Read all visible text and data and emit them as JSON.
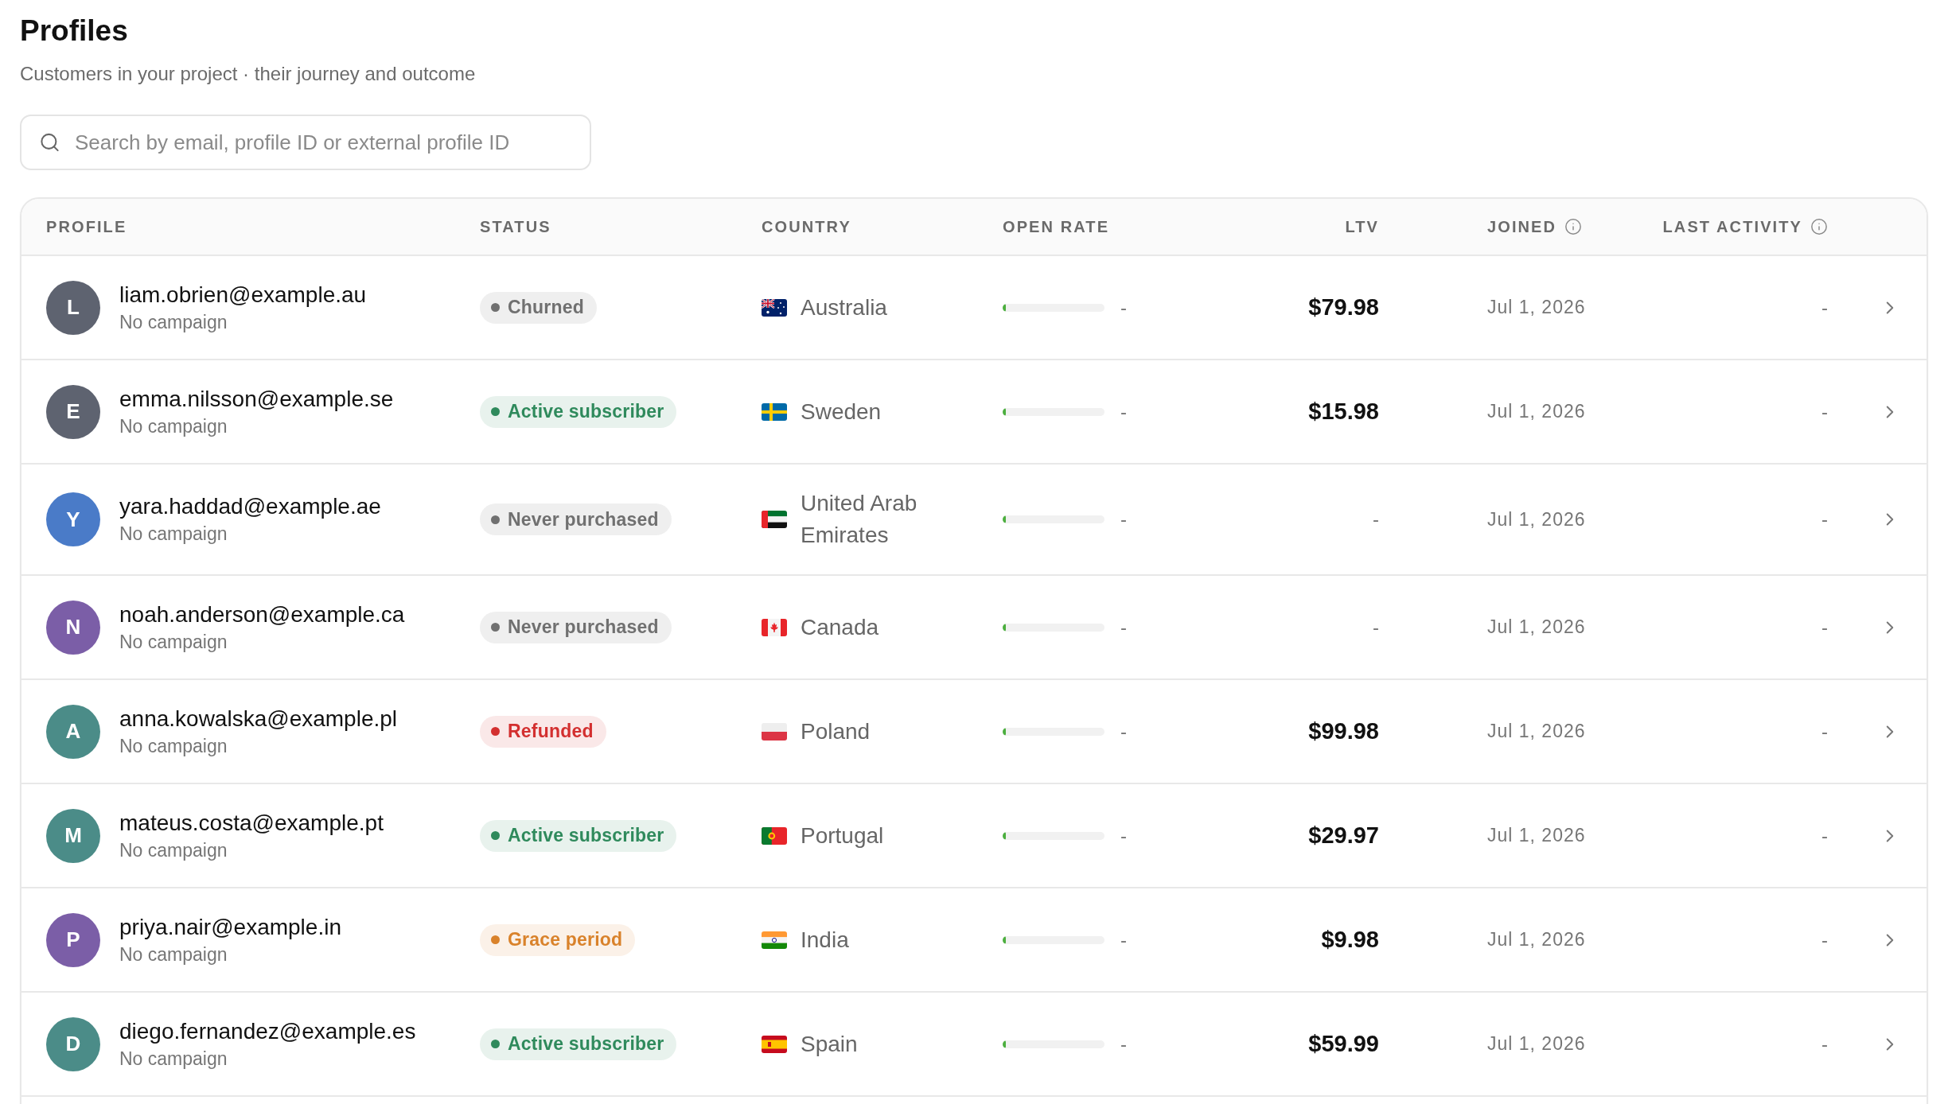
{
  "page": {
    "title": "Profiles",
    "subtitle": "Customers in your project · their journey and outcome"
  },
  "search": {
    "placeholder": "Search by email, profile ID or external profile ID"
  },
  "table": {
    "columns": [
      {
        "label": "PROFILE",
        "info": false
      },
      {
        "label": "STATUS",
        "info": false
      },
      {
        "label": "COUNTRY",
        "info": false
      },
      {
        "label": "OPEN RATE",
        "info": false
      },
      {
        "label": "LTV",
        "info": false
      },
      {
        "label": "JOINED",
        "info": true
      },
      {
        "label": "LAST ACTIVITY",
        "info": true
      }
    ],
    "rows": [
      {
        "avatar": {
          "initial": "L",
          "color": "#5e6370"
        },
        "email": "liam.obrien@example.au",
        "campaign": "No campaign",
        "status": {
          "label": "Churned",
          "color": "#707070"
        },
        "country": {
          "kind": "au",
          "name": "Australia"
        },
        "open_rate": {
          "level": 0.03,
          "reading": "-"
        },
        "ltv": {
          "kind": "amount",
          "text": "$79.98"
        },
        "joined": "Jul 1, 2026",
        "last_activity": "-"
      },
      {
        "avatar": {
          "initial": "E",
          "color": "#5e6370"
        },
        "email": "emma.nilsson@example.se",
        "campaign": "No campaign",
        "status": {
          "label": "Active subscriber",
          "color": "#2f8a5c"
        },
        "country": {
          "kind": "se",
          "name": "Sweden"
        },
        "open_rate": {
          "level": 0.03,
          "reading": "-"
        },
        "ltv": {
          "kind": "amount",
          "text": "$15.98"
        },
        "joined": "Jul 1, 2026",
        "last_activity": "-"
      },
      {
        "avatar": {
          "initial": "Y",
          "color": "#4a7bc8"
        },
        "email": "yara.haddad@example.ae",
        "campaign": "No campaign",
        "status": {
          "label": "Never purchased",
          "color": "#707070"
        },
        "country": {
          "kind": "ae",
          "name": "United Arab Emirates"
        },
        "open_rate": {
          "level": 0.03,
          "reading": "-"
        },
        "ltv": {
          "kind": "missing",
          "text": "-"
        },
        "joined": "Jul 1, 2026",
        "last_activity": "-"
      },
      {
        "avatar": {
          "initial": "N",
          "color": "#7b5ea7"
        },
        "email": "noah.anderson@example.ca",
        "campaign": "No campaign",
        "status": {
          "label": "Never purchased",
          "color": "#707070"
        },
        "country": {
          "kind": "ca",
          "name": "Canada"
        },
        "open_rate": {
          "level": 0.03,
          "reading": "-"
        },
        "ltv": {
          "kind": "missing",
          "text": "-"
        },
        "joined": "Jul 1, 2026",
        "last_activity": "-"
      },
      {
        "avatar": {
          "initial": "A",
          "color": "#4b8c88"
        },
        "email": "anna.kowalska@example.pl",
        "campaign": "No campaign",
        "status": {
          "label": "Refunded",
          "color": "#d32f2f"
        },
        "country": {
          "kind": "pl",
          "name": "Poland"
        },
        "open_rate": {
          "level": 0.03,
          "reading": "-"
        },
        "ltv": {
          "kind": "amount",
          "text": "$99.98"
        },
        "joined": "Jul 1, 2026",
        "last_activity": "-"
      },
      {
        "avatar": {
          "initial": "M",
          "color": "#4b8c88"
        },
        "email": "mateus.costa@example.pt",
        "campaign": "No campaign",
        "status": {
          "label": "Active subscriber",
          "color": "#2f8a5c"
        },
        "country": {
          "kind": "pt",
          "name": "Portugal"
        },
        "open_rate": {
          "level": 0.03,
          "reading": "-"
        },
        "ltv": {
          "kind": "amount",
          "text": "$29.97"
        },
        "joined": "Jul 1, 2026",
        "last_activity": "-"
      },
      {
        "avatar": {
          "initial": "P",
          "color": "#7b5ea7"
        },
        "email": "priya.nair@example.in",
        "campaign": "No campaign",
        "status": {
          "label": "Grace period",
          "color": "#d9822b"
        },
        "country": {
          "kind": "in",
          "name": "India"
        },
        "open_rate": {
          "level": 0.03,
          "reading": "-"
        },
        "ltv": {
          "kind": "amount",
          "text": "$9.98"
        },
        "joined": "Jul 1, 2026",
        "last_activity": "-"
      },
      {
        "avatar": {
          "initial": "D",
          "color": "#4b8c88"
        },
        "email": "diego.fernandez@example.es",
        "campaign": "No campaign",
        "status": {
          "label": "Active subscriber",
          "color": "#2f8a5c"
        },
        "country": {
          "kind": "es",
          "name": "Spain"
        },
        "open_rate": {
          "level": 0.03,
          "reading": "-"
        },
        "ltv": {
          "kind": "amount",
          "text": "$59.99"
        },
        "joined": "Jul 1, 2026",
        "last_activity": "-"
      }
    ]
  }
}
